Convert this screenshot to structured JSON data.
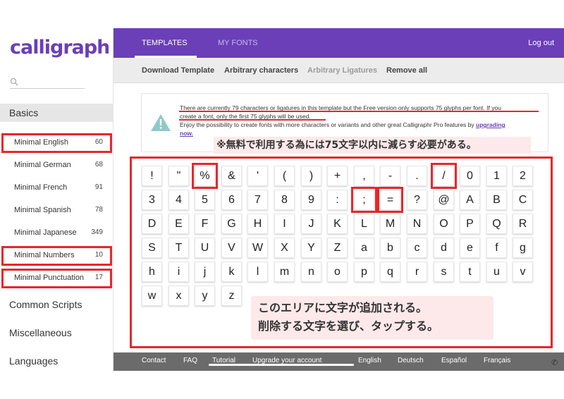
{
  "app": {
    "logo_text": "calligraphr"
  },
  "search": {
    "placeholder": ""
  },
  "sidebar": {
    "basics_label": "Basics",
    "items": [
      {
        "label": "Minimal English",
        "count": "60"
      },
      {
        "label": "Minimal German",
        "count": "68"
      },
      {
        "label": "Minimal French",
        "count": "91"
      },
      {
        "label": "Minimal Spanish",
        "count": "78"
      },
      {
        "label": "Minimal Japanese",
        "count": "349"
      },
      {
        "label": "Minimal Numbers",
        "count": "10"
      },
      {
        "label": "Minimal Punctuation",
        "count": "17"
      }
    ],
    "categories": [
      "Common Scripts",
      "Miscellaneous",
      "Languages"
    ]
  },
  "topbar": {
    "tabs": [
      "TEMPLATES",
      "MY FONTS"
    ],
    "logout": "Log out"
  },
  "subbar": {
    "items": [
      "Download Template",
      "Arbitrary characters",
      "Arbitrary Ligatures",
      "Remove all"
    ]
  },
  "notice": {
    "line1": "There are currently 79 characters or ligatures in this template but the Free version only supports 75 glyphs per font. If you",
    "line2": "create a font, only the first 75 glyphs will be used.",
    "line3": "Enjoy the possibility to create fonts with more characters or variants and other great Calligraphr Pro features by ",
    "link_a": "upgrading",
    "link_b": "now."
  },
  "annotations": {
    "note_top": "※無料で利用する為には75文字以内に減らす必要がある。",
    "callout_line1": "このエリアに文字が追加される。",
    "callout_line2": "削除する文字を選び、タップする。"
  },
  "glyphs": [
    [
      "!",
      "\"",
      "%",
      "&",
      "'",
      "(",
      ")",
      "+",
      ",",
      "-",
      ".",
      "/",
      "0",
      "1",
      "2"
    ],
    [
      "3",
      "4",
      "5",
      "6",
      "7",
      "8",
      "9",
      ":",
      ";",
      "=",
      "?",
      "@",
      "A",
      "B",
      "C"
    ],
    [
      "D",
      "E",
      "F",
      "G",
      "H",
      "I",
      "J",
      "K",
      "L",
      "M",
      "N",
      "O",
      "P",
      "Q",
      "R"
    ],
    [
      "S",
      "T",
      "U",
      "V",
      "W",
      "X",
      "Y",
      "Z",
      "a",
      "b",
      "c",
      "d",
      "e",
      "f",
      "g"
    ],
    [
      "h",
      "i",
      "j",
      "k",
      "l",
      "m",
      "n",
      "o",
      "p",
      "q",
      "r",
      "s",
      "t",
      "u",
      "v"
    ],
    [
      "w",
      "x",
      "y",
      "z"
    ]
  ],
  "footer": {
    "links": [
      "Contact",
      "FAQ",
      "Tutorial",
      "Upgrade your account",
      "English",
      "Deutsch",
      "Español",
      "Français"
    ]
  },
  "colors": {
    "brand_purple": "#6a3fb8",
    "highlight_red": "#e8262b",
    "callout_pink": "#fde9ea",
    "footer_gray": "#6b6b6b"
  }
}
